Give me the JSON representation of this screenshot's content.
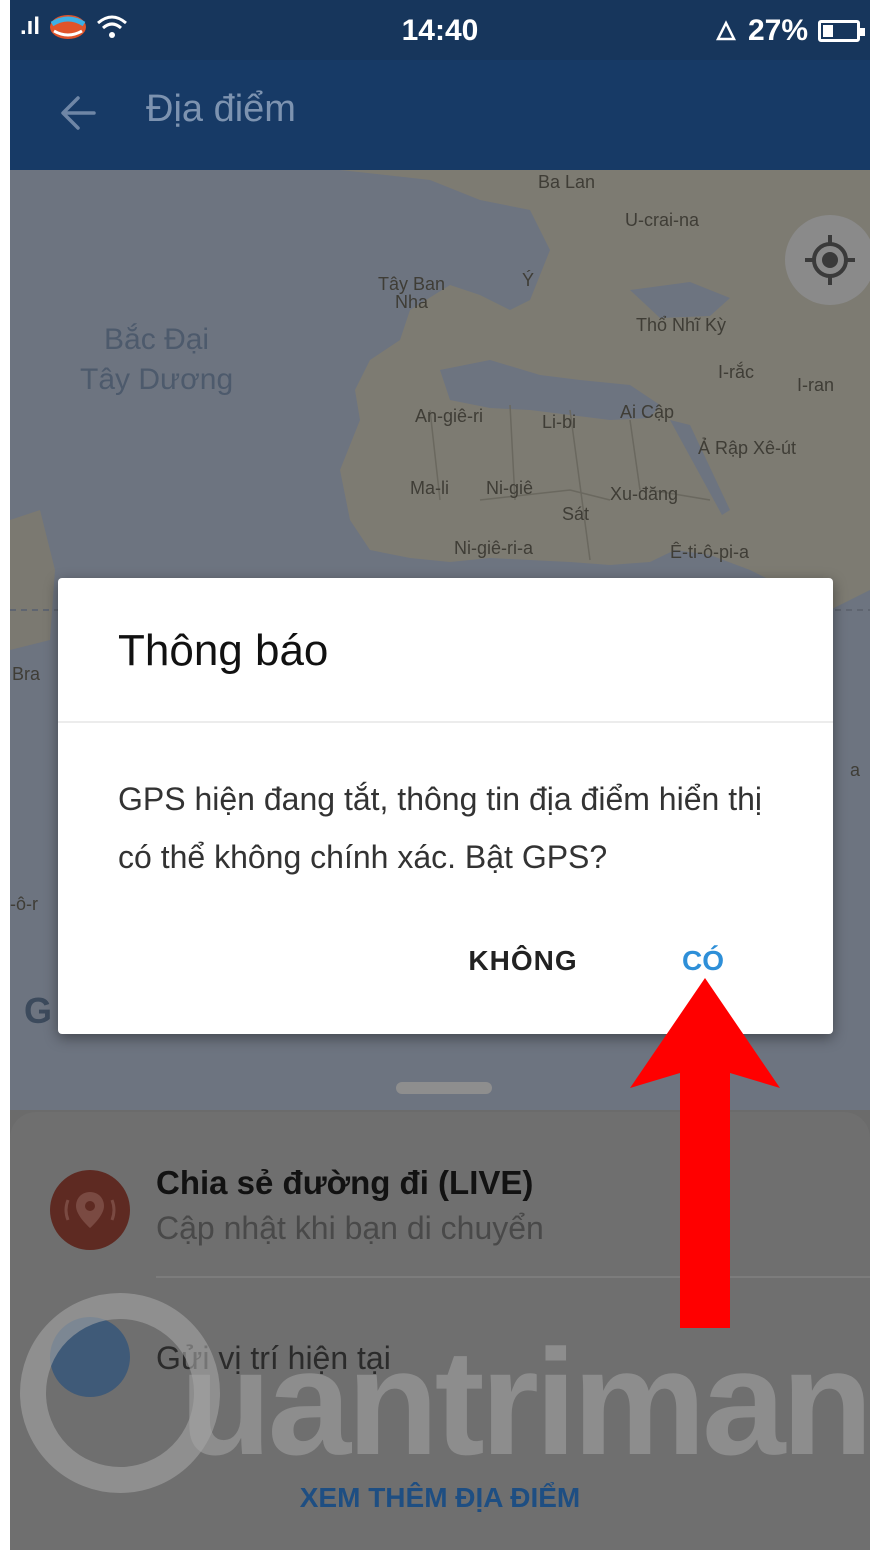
{
  "status_bar": {
    "time": "14:40",
    "battery_text": "27%",
    "signal_text": ".ıl"
  },
  "app_bar": {
    "title": "Địa điểm"
  },
  "map": {
    "ocean_label": "Bắc Đại\nTây Dương",
    "labels": [
      "Ba Lan",
      "U-crai-na",
      "Tây Ban\nNha",
      "Ý",
      "Thổ Nhĩ Kỳ",
      "I-rắc",
      "I-ran",
      "An-giê-ri",
      "Li-bi",
      "Ai Cập",
      "Ả Rập Xê-út",
      "Ma-li",
      "Ni-giê",
      "Sát",
      "Xu-đăng",
      "Ni-giê-ri-a",
      "Ê-ti-ô-pi-a",
      "Bra",
      "a",
      "-ô-r"
    ],
    "google_logo": "G"
  },
  "dialog": {
    "title": "Thông báo",
    "message": "GPS hiện đang tắt, thông tin địa điểm hiển thị có thể không chính xác. Bật GPS?",
    "negative_label": "KHÔNG",
    "positive_label": "CÓ"
  },
  "bottom_sheet": {
    "live_title": "Chia sẻ đường đi (LIVE)",
    "live_subtitle": "Cập nhật khi bạn di chuyển",
    "current_location_label": "Gửi vị trí hiện tại",
    "see_more_label": "XEM THÊM ĐỊA ĐIỂM"
  },
  "watermark": {
    "text": "uantrimang"
  },
  "colors": {
    "app_bar": "#173a66",
    "accent_blue": "#2e8fd8",
    "annotation_red": "#ff0000"
  },
  "icons": [
    "back-arrow-icon",
    "my-location-icon",
    "live-location-icon",
    "current-location-icon",
    "wifi-icon",
    "carrier-icon",
    "battery-icon",
    "alarm-icon"
  ]
}
